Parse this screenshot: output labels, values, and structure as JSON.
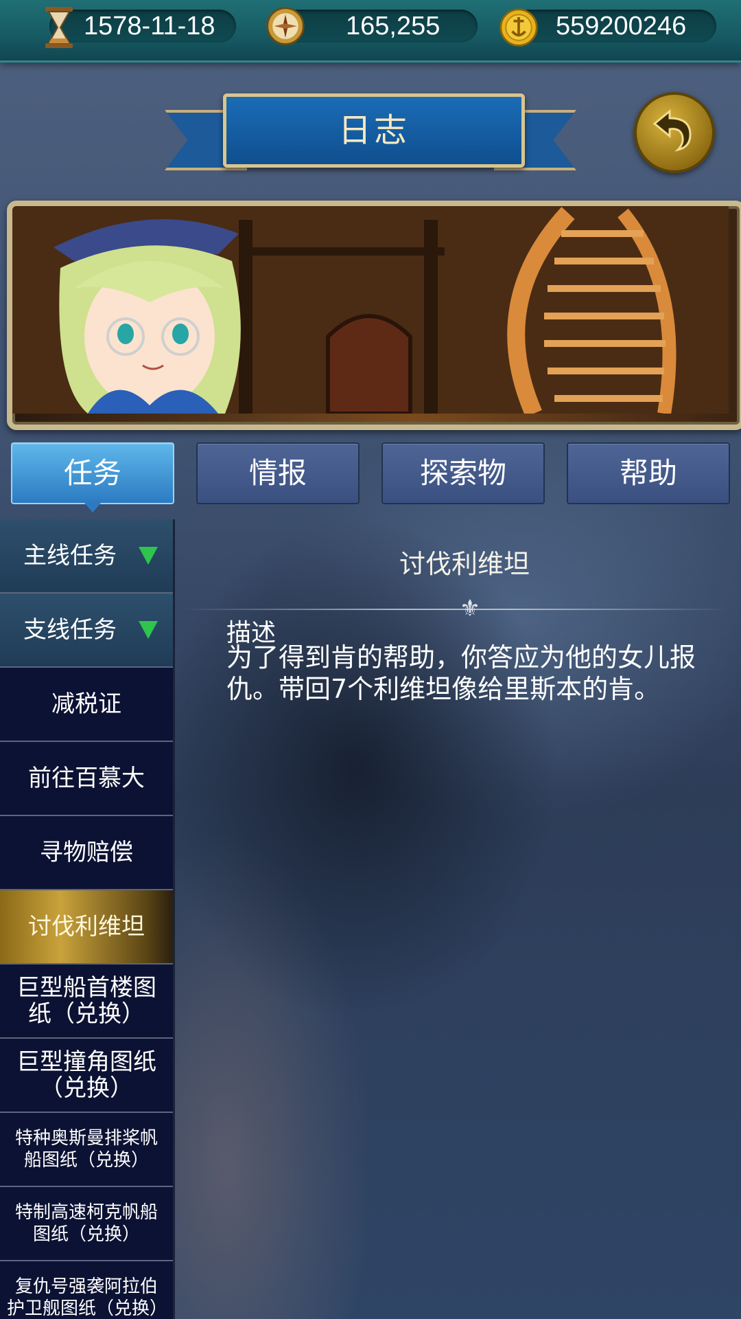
{
  "topbar": {
    "date": "1578-11-18",
    "reputation": "165,255",
    "gold": "559200246"
  },
  "header": {
    "title": "日志"
  },
  "tabs": [
    {
      "label": "任务"
    },
    {
      "label": "情报"
    },
    {
      "label": "探索物"
    },
    {
      "label": "帮助"
    }
  ],
  "sidebar": {
    "items": [
      {
        "label": "主线任务"
      },
      {
        "label": "支线任务"
      },
      {
        "label": "减税证"
      },
      {
        "label": "前往百慕大"
      },
      {
        "label": "寻物赔偿"
      },
      {
        "label": "讨伐利维坦"
      },
      {
        "label": "巨型船首楼图纸（兑换）"
      },
      {
        "label": "巨型撞角图纸（兑换）"
      },
      {
        "label": "特种奥斯曼排桨帆船图纸（兑换）"
      },
      {
        "label": "特制高速柯克帆船图纸（兑换）"
      },
      {
        "label": "复仇号强袭阿拉伯护卫舰图纸（兑换）"
      }
    ]
  },
  "detail": {
    "title": "讨伐利维坦",
    "desc_label": "描述",
    "desc_text": "为了得到肯的帮助，你答应为他的女儿报仇。带回7个利维坦像给里斯本的肯。"
  },
  "colors": {
    "active_tab": "#2c7bc2",
    "inactive_tab": "#3a5080",
    "selected_item": "#c9a23b",
    "category_arrow": "#2fc44e"
  }
}
